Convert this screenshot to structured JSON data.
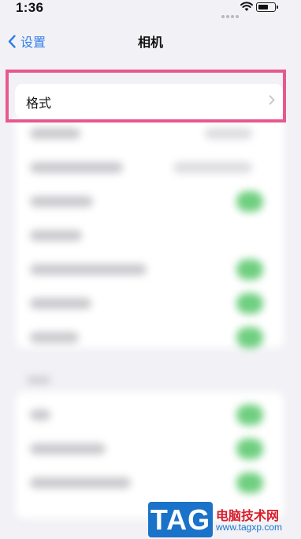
{
  "status_bar": {
    "time": "1:36"
  },
  "nav": {
    "back_label": "设置",
    "title": "相机"
  },
  "format_row": {
    "label": "格式"
  },
  "watermark": {
    "badge": "TAG",
    "name": "电脑技术网",
    "url": "www.tagxp.com"
  },
  "colors": {
    "accent": "#2f7fe8",
    "highlight": "#e8588e",
    "toggle_on": "#6fcf7f",
    "watermark_blue": "#1a73c9",
    "watermark_red": "#d81e2c"
  }
}
